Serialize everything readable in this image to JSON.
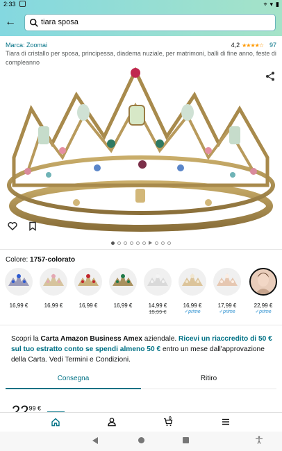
{
  "status_bar": {
    "time": "2:33"
  },
  "search": {
    "query": "tiara sposa"
  },
  "product": {
    "brand": "Marca: Zoomai",
    "rating": "4,2",
    "stars": "★★★★☆",
    "review_count": "97",
    "title": "Tiara di cristallo per sposa, principessa, diadema nuziale, per matrimoni, balli di fine anno, feste di compleanno"
  },
  "color": {
    "label": "Colore:",
    "selected": "1757-colorato"
  },
  "swatches": [
    {
      "price": "16,99 €",
      "old_price": "",
      "prime": ""
    },
    {
      "price": "16,99 €",
      "old_price": "",
      "prime": ""
    },
    {
      "price": "16,99 €",
      "old_price": "",
      "prime": ""
    },
    {
      "price": "16,99 €",
      "old_price": "",
      "prime": ""
    },
    {
      "price": "14,99 €",
      "old_price": "15,99 €",
      "prime": ""
    },
    {
      "price": "16,99 €",
      "old_price": "",
      "prime": "✓prime"
    },
    {
      "price": "17,99 €",
      "old_price": "",
      "prime": "✓prime"
    },
    {
      "price": "22,99 €",
      "old_price": "",
      "prime": "✓prime"
    }
  ],
  "promo": {
    "part1": "Scopri la ",
    "card": "Carta Amazon Business Amex",
    "part2": " aziendale. ",
    "highlight": "Ricevi un riaccredito di 50 € sul tuo estratto conto se spendi almeno 50 €",
    "part3": " entro un mese dall'approvazione della Carta. Vedi Termini e Condizioni."
  },
  "tabs": {
    "delivery": "Consegna",
    "pickup": "Ritiro"
  },
  "price_peek": {
    "whole": "22",
    "cents": "99 €"
  },
  "bottom_nav": {
    "cart_count": "0"
  },
  "colors": {
    "teal": "#007185",
    "header_start": "#84d8e0",
    "header_end": "#a5e3c8",
    "star": "#ff9900"
  }
}
